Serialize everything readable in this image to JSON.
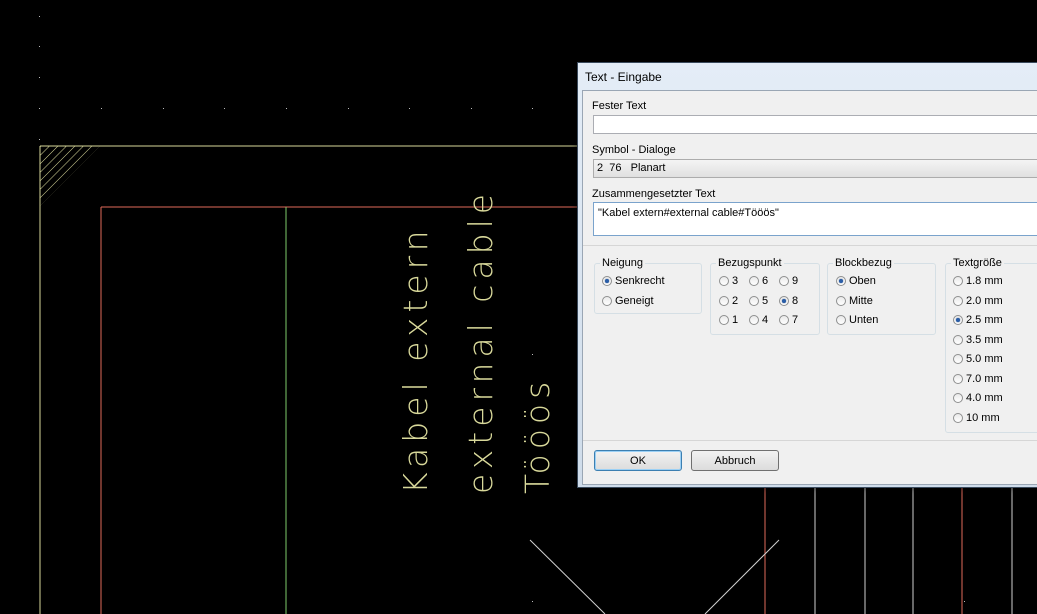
{
  "canvas": {
    "text_lines": [
      "Kabel extern",
      "external cable",
      "Tööös"
    ],
    "colors": {
      "background": "#000000",
      "border_line": "#d8d89a",
      "red_line": "#e06a5a",
      "green_line": "#7ecb6a",
      "white_line": "#d0d0d0"
    }
  },
  "dialog": {
    "title": "Text - Eingabe",
    "fester_text": {
      "label": "Fester Text",
      "value": ""
    },
    "symbol": {
      "label": "Symbol - Dialoge",
      "value": "2  76   Planart"
    },
    "zusammen": {
      "label": "Zusammengesetzter Text",
      "value": "\"Kabel extern#external cable#Tööös\""
    },
    "neigung": {
      "title": "Neigung",
      "options": [
        {
          "label": "Senkrecht",
          "selected": true
        },
        {
          "label": "Geneigt",
          "selected": false
        }
      ]
    },
    "bezugspunkt": {
      "title": "Bezugspunkt",
      "options": [
        {
          "label": "3",
          "selected": false
        },
        {
          "label": "6",
          "selected": false
        },
        {
          "label": "9",
          "selected": false
        },
        {
          "label": "2",
          "selected": false
        },
        {
          "label": "5",
          "selected": false
        },
        {
          "label": "8",
          "selected": true
        },
        {
          "label": "1",
          "selected": false
        },
        {
          "label": "4",
          "selected": false
        },
        {
          "label": "7",
          "selected": false
        }
      ]
    },
    "blockbezug": {
      "title": "Blockbezug",
      "options": [
        {
          "label": "Oben",
          "selected": true
        },
        {
          "label": "Mitte",
          "selected": false
        },
        {
          "label": "Unten",
          "selected": false
        }
      ]
    },
    "textgroesse": {
      "title": "Textgröße",
      "options": [
        {
          "label": "1.8 mm",
          "selected": false
        },
        {
          "label": "2.0 mm",
          "selected": false
        },
        {
          "label": "2.5 mm",
          "selected": true
        },
        {
          "label": "3.5 mm",
          "selected": false
        },
        {
          "label": "5.0 mm",
          "selected": false
        },
        {
          "label": "7.0 mm",
          "selected": false
        },
        {
          "label": "4.0 mm",
          "selected": false
        },
        {
          "label": "10 mm",
          "selected": false
        }
      ]
    },
    "buttons": {
      "ok": "OK",
      "cancel": "Abbruch"
    }
  }
}
